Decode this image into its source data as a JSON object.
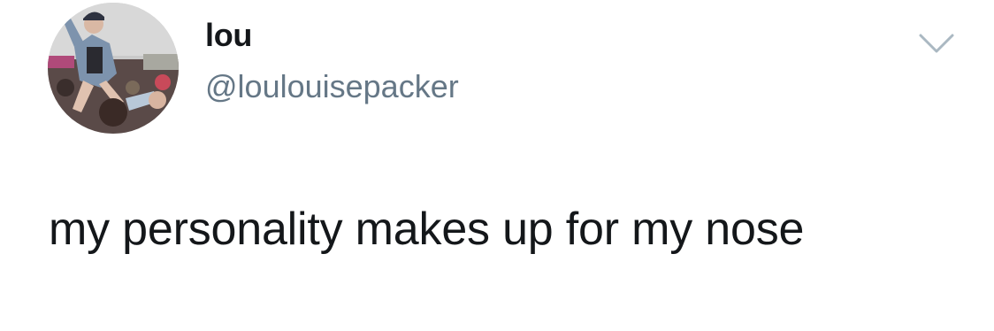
{
  "tweet": {
    "author": {
      "display_name": "lou",
      "handle": "@loulouisepacker",
      "avatar": "profile-photo-crowd"
    },
    "menu_icon": "chevron-down-icon",
    "text": "my personality makes up for my nose"
  },
  "colors": {
    "background": "#ffffff",
    "primary_text": "#14171a",
    "secondary_text": "#657786",
    "icon": "#aab8c2"
  }
}
